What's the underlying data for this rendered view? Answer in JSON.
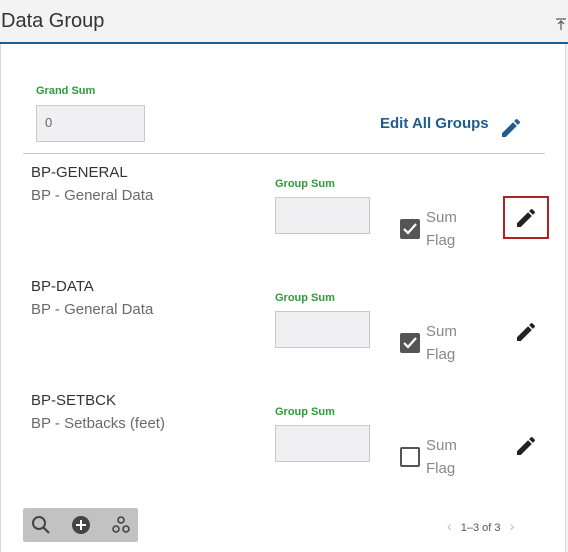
{
  "header": {
    "title": "Data Group",
    "collapse_icon": "collapse-up-icon"
  },
  "grand_sum": {
    "label": "Grand Sum",
    "value": "0"
  },
  "edit_all": {
    "label": "Edit All Groups",
    "icon": "pencil-icon"
  },
  "groups": [
    {
      "code": "BP-GENERAL",
      "description": "BP - General Data",
      "group_sum_label": "Group Sum",
      "group_sum_value": "",
      "sum_flag_label": "Sum Flag",
      "sum_flag_checked": true,
      "edit_highlighted": true
    },
    {
      "code": "BP-DATA",
      "description": "BP - General Data",
      "group_sum_label": "Group Sum",
      "group_sum_value": "",
      "sum_flag_label": "Sum Flag",
      "sum_flag_checked": true,
      "edit_highlighted": false
    },
    {
      "code": "BP-SETBCK",
      "description": "BP - Setbacks (feet)",
      "group_sum_label": "Group Sum",
      "group_sum_value": "",
      "sum_flag_label": "Sum Flag",
      "sum_flag_checked": false,
      "edit_highlighted": false
    }
  ],
  "toolbar": {
    "icons": [
      "search-icon",
      "add-circle-icon",
      "settings-gears-icon"
    ]
  },
  "pager": {
    "text": "1–3 of 3"
  },
  "colors": {
    "accent": "#1f5d8f",
    "label_green": "#2e9a3a",
    "highlight_red": "#b22222"
  }
}
